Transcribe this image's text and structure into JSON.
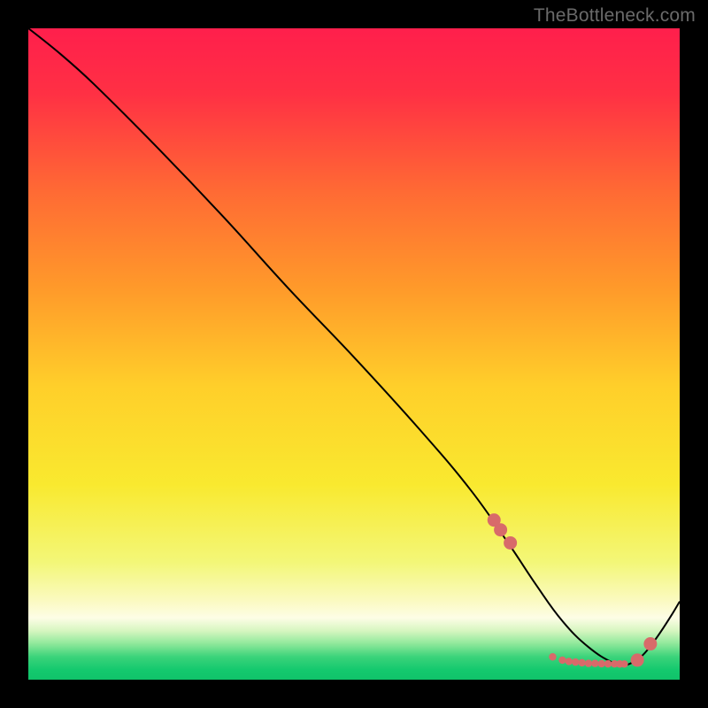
{
  "watermark": "TheBottleneck.com",
  "chart_data": {
    "type": "line",
    "title": "",
    "xlabel": "",
    "ylabel": "",
    "xlim": [
      0,
      100
    ],
    "ylim": [
      0,
      100
    ],
    "grid": false,
    "legend": false,
    "series": [
      {
        "name": "main-curve",
        "x": [
          0,
          5,
          10,
          20,
          30,
          40,
          50,
          60,
          68,
          74,
          78,
          82,
          86,
          90,
          92,
          95,
          100
        ],
        "y": [
          100,
          96,
          91.5,
          81.5,
          71,
          60,
          49.5,
          38.5,
          29,
          20.5,
          14.5,
          9,
          5,
          2.5,
          2.3,
          4.5,
          12
        ],
        "color": "#000000"
      }
    ],
    "markers": {
      "name": "marker-dots",
      "color": "#d86a6a",
      "big": [
        [
          71.5,
          24.5
        ],
        [
          72.5,
          23
        ],
        [
          74,
          21
        ],
        [
          93.5,
          3
        ],
        [
          95.5,
          5.5
        ]
      ],
      "small": [
        [
          80.5,
          3.5
        ],
        [
          82,
          3
        ],
        [
          83,
          2.8
        ],
        [
          84,
          2.7
        ],
        [
          85,
          2.6
        ],
        [
          86,
          2.5
        ],
        [
          87,
          2.5
        ],
        [
          88,
          2.45
        ],
        [
          89,
          2.43
        ],
        [
          90,
          2.42
        ],
        [
          90.8,
          2.41
        ],
        [
          91.5,
          2.4
        ]
      ]
    },
    "gradient_stops": [
      {
        "pos": 0.0,
        "color": "#ff1f4c"
      },
      {
        "pos": 0.1,
        "color": "#ff3044"
      },
      {
        "pos": 0.25,
        "color": "#ff6a34"
      },
      {
        "pos": 0.4,
        "color": "#ff9a2a"
      },
      {
        "pos": 0.55,
        "color": "#ffcf2a"
      },
      {
        "pos": 0.7,
        "color": "#f9e92f"
      },
      {
        "pos": 0.82,
        "color": "#f3f778"
      },
      {
        "pos": 0.88,
        "color": "#fbfac2"
      },
      {
        "pos": 0.905,
        "color": "#fdfde6"
      },
      {
        "pos": 0.925,
        "color": "#d6f6c0"
      },
      {
        "pos": 0.945,
        "color": "#8ee89a"
      },
      {
        "pos": 0.965,
        "color": "#3bd37a"
      },
      {
        "pos": 0.985,
        "color": "#14c96e"
      },
      {
        "pos": 1.0,
        "color": "#10c36a"
      }
    ]
  }
}
